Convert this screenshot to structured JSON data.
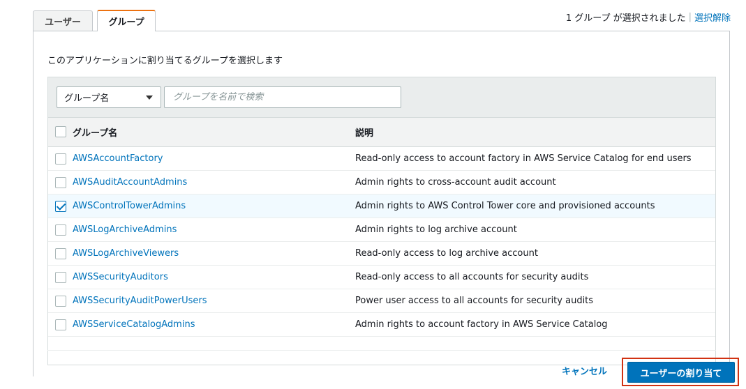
{
  "tabs": [
    {
      "label": "ユーザー"
    },
    {
      "label": "グループ"
    }
  ],
  "selection_status": {
    "text": "1 グループ が選択されました",
    "clear_label": "選択解除"
  },
  "instruction": "このアプリケーションに割り当てるグループを選択します",
  "filter": {
    "select_value": "グループ名",
    "placeholder": "グループを名前で検索"
  },
  "table": {
    "headers": {
      "name": "グループ名",
      "description": "説明"
    },
    "rows": [
      {
        "name": "AWSAccountFactory",
        "description": "Read-only access to account factory in AWS Service Catalog for end users",
        "checked": false
      },
      {
        "name": "AWSAuditAccountAdmins",
        "description": "Admin rights to cross-account audit account",
        "checked": false
      },
      {
        "name": "AWSControlTowerAdmins",
        "description": "Admin rights to AWS Control Tower core and provisioned accounts",
        "checked": true
      },
      {
        "name": "AWSLogArchiveAdmins",
        "description": "Admin rights to log archive account",
        "checked": false
      },
      {
        "name": "AWSLogArchiveViewers",
        "description": "Read-only access to log archive account",
        "checked": false
      },
      {
        "name": "AWSSecurityAuditors",
        "description": "Read-only access to all accounts for security audits",
        "checked": false
      },
      {
        "name": "AWSSecurityAuditPowerUsers",
        "description": "Power user access to all accounts for security audits",
        "checked": false
      },
      {
        "name": "AWSServiceCatalogAdmins",
        "description": "Admin rights to account factory in AWS Service Catalog",
        "checked": false
      }
    ]
  },
  "actions": {
    "cancel_label": "キャンセル",
    "assign_label": "ユーザーの割り当て"
  },
  "colors": {
    "accent_tab": "#ec7211",
    "link": "#0073bb",
    "primary_button": "#0073bb",
    "highlight_outline": "#d13212"
  }
}
